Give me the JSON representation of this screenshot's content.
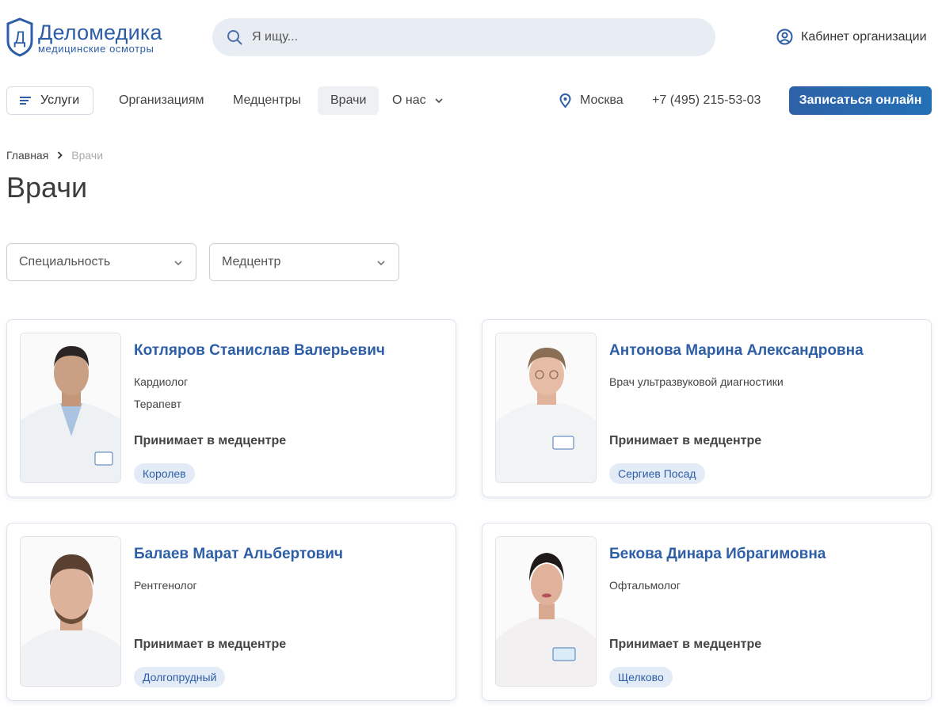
{
  "brand": {
    "logo_letter": "Д",
    "name": "Деломедика",
    "tagline": "медицинские осмотры",
    "accent_color": "#2d5ea6"
  },
  "header": {
    "search_placeholder": "Я ищу...",
    "search_icon": "search-icon",
    "cabinet_label": "Кабинет организации",
    "cabinet_icon": "user-circle-icon"
  },
  "nav": {
    "services_label": "Услуги",
    "links": [
      {
        "label": "Организациям"
      },
      {
        "label": "Медцентры"
      },
      {
        "label": "Врачи",
        "active": true
      },
      {
        "label": "О нас"
      }
    ],
    "city": "Москва",
    "phone": "+7 (495) 215-53-03",
    "book_label": "Записаться онлайн"
  },
  "breadcrumb": {
    "home": "Главная",
    "current": "Врачи"
  },
  "page_title": "Врачи",
  "filters": {
    "specialty_placeholder": "Специальность",
    "center_placeholder": "Медцентр"
  },
  "doctors": [
    {
      "name": "Котляров Станислав Валерьевич",
      "specialties": [
        "Кардиолог",
        "Терапевт"
      ],
      "receives_label": "Принимает в медцентре",
      "center": "Королев"
    },
    {
      "name": "Антонова Марина Александровна",
      "specialties": [
        "Врач ультразвуковой диагностики"
      ],
      "receives_label": "Принимает в медцентре",
      "center": "Сергиев Посад"
    },
    {
      "name": "Балаев Марат Альбертович",
      "specialties": [
        "Рентгенолог"
      ],
      "receives_label": "Принимает в медцентре",
      "center": "Долгопрудный"
    },
    {
      "name": "Бекова Динара Ибрагимовна",
      "specialties": [
        "Офтальмолог"
      ],
      "receives_label": "Принимает в медцентре",
      "center": "Щелково"
    }
  ]
}
